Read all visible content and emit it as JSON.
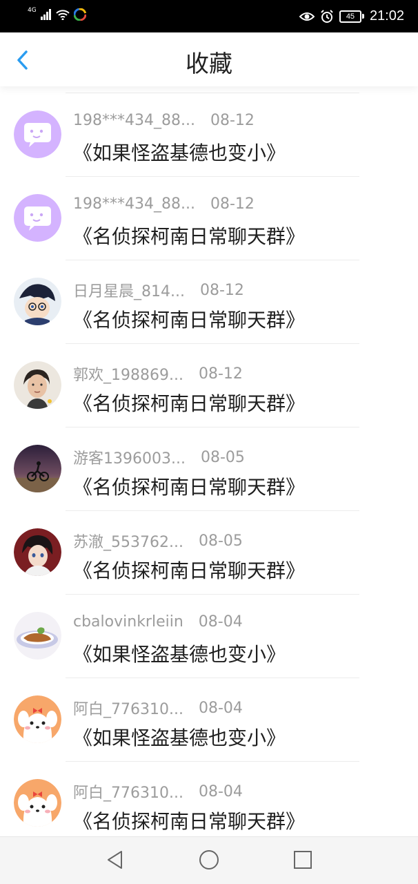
{
  "status_bar": {
    "network": "4G",
    "time": "21:02",
    "battery": "45"
  },
  "header": {
    "title": "收藏",
    "back_icon": "chevron-left-icon"
  },
  "items": [
    {
      "name": "198***434_88...",
      "date": "08-12",
      "group": "《如果怪盗基德也变小》",
      "avatar": "purple-chat-default"
    },
    {
      "name": "198***434_88...",
      "date": "08-12",
      "group": "《名侦探柯南日常聊天群》",
      "avatar": "purple-chat-default"
    },
    {
      "name": "日月星晨_814...",
      "date": "08-12",
      "group": "《名侦探柯南日常聊天群》",
      "avatar": "anime-detective-photo"
    },
    {
      "name": "郭欢_198869...",
      "date": "08-12",
      "group": "《名侦探柯南日常聊天群》",
      "avatar": "person-photo"
    },
    {
      "name": "游客1396003...",
      "date": "08-05",
      "group": "《名侦探柯南日常聊天群》",
      "avatar": "motorbike-sunset-photo"
    },
    {
      "name": "苏澈_553762...",
      "date": "08-05",
      "group": "《名侦探柯南日常聊天群》",
      "avatar": "anime-boy-photo"
    },
    {
      "name": "cbalovinkrleiin",
      "date": "08-04",
      "group": "《如果怪盗基德也变小》",
      "avatar": "food-plate-photo"
    },
    {
      "name": "阿白_776310...",
      "date": "08-04",
      "group": "《如果怪盗基德也变小》",
      "avatar": "cute-dog-cartoon"
    },
    {
      "name": "阿白_776310...",
      "date": "08-04",
      "group": "《名侦探柯南日常聊天群》",
      "avatar": "cute-dog-cartoon"
    }
  ],
  "colors": {
    "accent": "#2a9cf0",
    "default_avatar": "#d4b3ff"
  }
}
